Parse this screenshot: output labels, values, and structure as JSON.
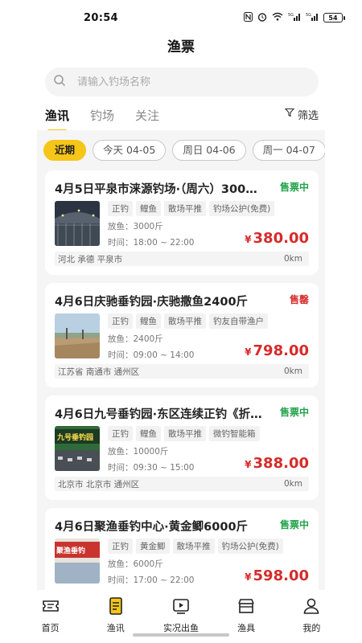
{
  "status_bar": {
    "time": "20:54",
    "signal": "5G",
    "battery": "54"
  },
  "page_title": "渔票",
  "search": {
    "placeholder": "请输入钓场名称"
  },
  "tabs": [
    {
      "label": "渔讯",
      "active": true
    },
    {
      "label": "钓场",
      "active": false
    },
    {
      "label": "关注",
      "active": false
    }
  ],
  "filter_label": "筛选",
  "dates": [
    "近期",
    "今天 04-05",
    "周日 04-06",
    "周一 04-07"
  ],
  "cards": [
    {
      "title": "4月5日平泉市涞源钓场·（周六）300…",
      "status": "售票中",
      "status_color": "#21a34a",
      "tags": [
        "正钓",
        "鲤鱼",
        "散场平推",
        "钓场公护(免费)"
      ],
      "fish_amount": "放鱼：3000斤",
      "time": "时间：18:00 ~ 22:00",
      "price_symbol": "¥",
      "price": "380.00",
      "location": "河北 承德 平泉市",
      "distance": "0km"
    },
    {
      "title": "4月6日庆驰垂钓园·庆驰撒鱼2400斤",
      "status": "售罄",
      "status_color": "#d62b2b",
      "tags": [
        "正钓",
        "鲤鱼",
        "散场平推",
        "钓友自带渔户"
      ],
      "fish_amount": "放鱼：2400斤",
      "time": "时间：09:00 ~ 14:00",
      "price_symbol": "¥",
      "price": "798.00",
      "location": "江苏省 南通市 通州区",
      "distance": "0km"
    },
    {
      "title": "4月6日九号垂钓园·东区连续正钓《折…",
      "status": "售票中",
      "status_color": "#21a34a",
      "tags": [
        "正钓",
        "鲤鱼",
        "散场平推",
        "微钓智能箱"
      ],
      "fish_amount": "放鱼：10000斤",
      "time": "时间：09:30 ~ 15:00",
      "price_symbol": "¥",
      "price": "388.00",
      "location": "北京市 北京市 通州区",
      "distance": "0km"
    },
    {
      "title": "4月6日聚渔垂钓中心·黄金鲫6000斤",
      "status": "售票中",
      "status_color": "#21a34a",
      "tags": [
        "正钓",
        "黄金鲫",
        "散场平推",
        "钓场公护(免费)"
      ],
      "fish_amount": "放鱼：6000斤",
      "time": "时间：17:00 ~ 22:00",
      "price_symbol": "¥",
      "price": "598.00",
      "location": "",
      "distance": ""
    }
  ],
  "thumb_texts": {
    "card3": "九号垂钓园",
    "card4": "聚渔垂钓"
  },
  "nav": [
    {
      "label": "首页",
      "icon": "ticket-icon"
    },
    {
      "label": "渔讯",
      "icon": "news-icon"
    },
    {
      "label": "实况出鱼",
      "icon": "video-icon"
    },
    {
      "label": "渔具",
      "icon": "shop-icon"
    },
    {
      "label": "我的",
      "icon": "user-icon"
    }
  ],
  "colors": {
    "accent": "#f5c518",
    "price": "#d62b2b",
    "on_sale": "#21a34a",
    "sold_out": "#d62b2b"
  }
}
